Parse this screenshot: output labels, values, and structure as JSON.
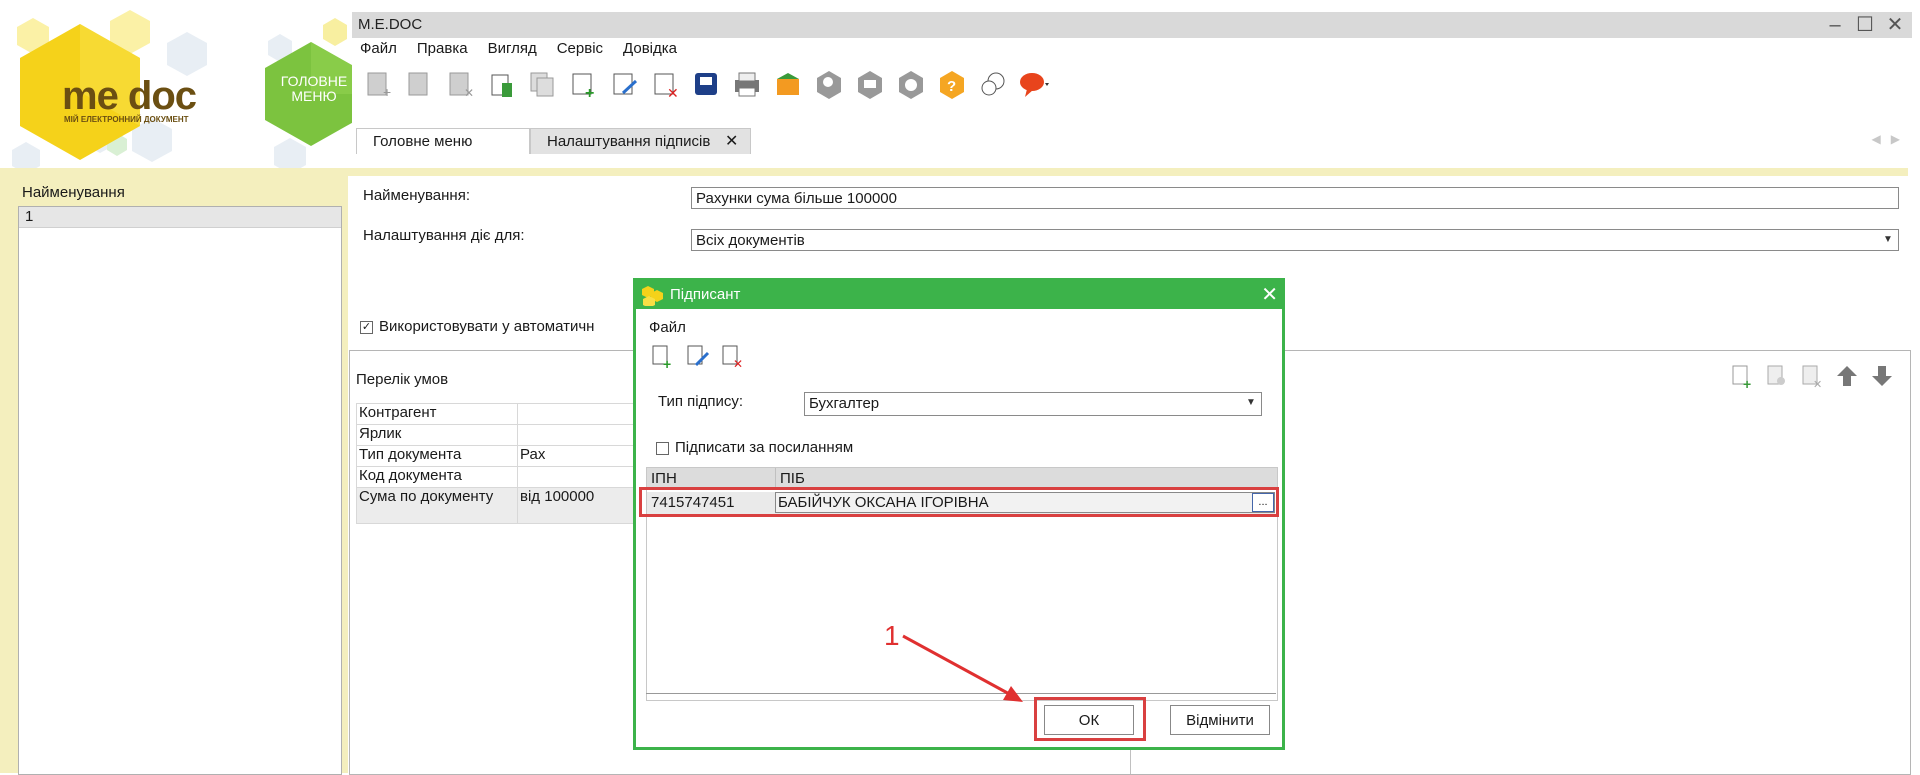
{
  "app": {
    "title": "M.E.DOC"
  },
  "brand": {
    "logo_text": "me doc",
    "logo_sub": "МІЙ ЕЛЕКТРОННИЙ ДОКУМЕНТ",
    "home_label": "ГОЛОВНЕ МЕНЮ"
  },
  "menubar": [
    "Файл",
    "Правка",
    "Вигляд",
    "Сервіс",
    "Довідка"
  ],
  "tabs": {
    "main": "Головне меню",
    "settings": "Налаштування підписів"
  },
  "left": {
    "header": "Найменування",
    "rows": [
      "1"
    ]
  },
  "form": {
    "name_label": "Найменування:",
    "name_value": "Рахунки сума більше 100000",
    "applies_label": "Налаштування діє для:",
    "applies_value": "Всіх документів",
    "auto_label": "Використовувати у автоматичн"
  },
  "conditions": {
    "title": "Перелік умов",
    "rows": [
      {
        "name": "Контрагент",
        "value": ""
      },
      {
        "name": "Ярлик",
        "value": ""
      },
      {
        "name": "Тип документа",
        "value": "Рах"
      },
      {
        "name": "Код документа",
        "value": ""
      },
      {
        "name": "Сума по документу",
        "value": "від 100000"
      }
    ]
  },
  "dialog": {
    "title": "Підписант",
    "menu": "Файл",
    "type_label": "Тип підпису:",
    "type_value": "Бухгалтер",
    "link_label": "Підписати за посиланням",
    "grid_headers": [
      "ІПН",
      "ПІБ"
    ],
    "grid_rows": [
      {
        "ipn": "7415747451",
        "pib": "БАБІЙЧУК ОКСАНА ІГОРІВНА"
      }
    ],
    "ellipsis": "...",
    "ok": "ОК",
    "cancel": "Відмінити"
  },
  "annotation": {
    "number": "1"
  },
  "colors": {
    "accent": "#3cb34a",
    "highlight": "#d94040",
    "panel": "#f4efbe",
    "logo_yellow": "#f5d21a"
  }
}
